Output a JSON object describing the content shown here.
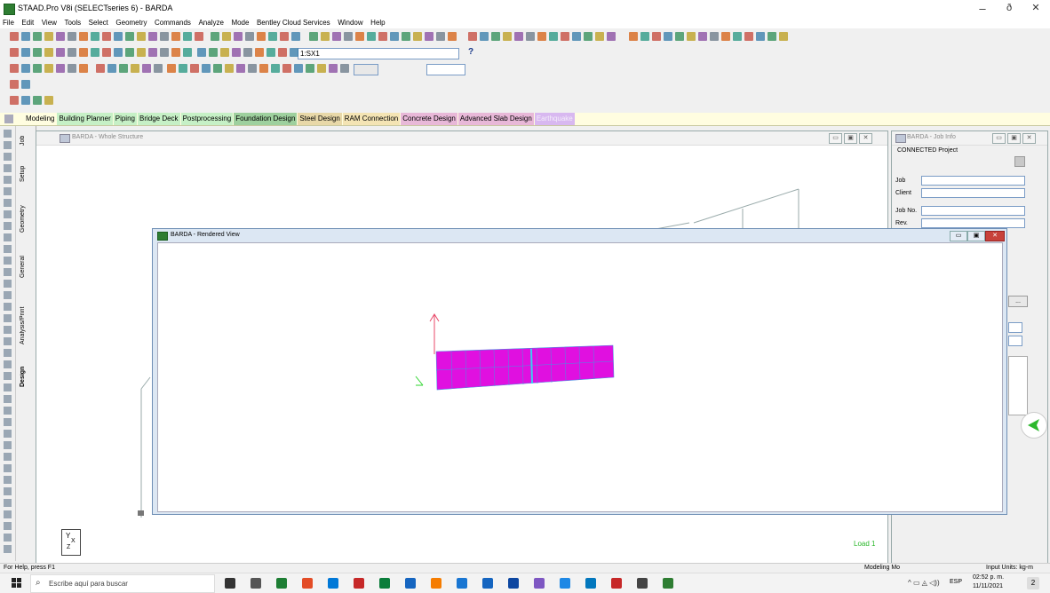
{
  "window": {
    "title": "STAAD.Pro V8i (SELECTseries 6) - BARDA",
    "controls": {
      "minimize": "–",
      "restore": "ð",
      "close": "✕"
    }
  },
  "menu": [
    "File",
    "Edit",
    "View",
    "Tools",
    "Select",
    "Geometry",
    "Commands",
    "Analyze",
    "Mode",
    "Bentley Cloud Services",
    "Window",
    "Help"
  ],
  "toolbar": {
    "load_combo": "1:SX1",
    "help_icon": "?"
  },
  "tabs": [
    {
      "label": "Modeling",
      "bg": "#fffde0"
    },
    {
      "label": "Building Planner",
      "bg": "#c6f0c6"
    },
    {
      "label": "Piping",
      "bg": "#c6f0c6"
    },
    {
      "label": "Bridge Deck",
      "bg": "#c6f0c6"
    },
    {
      "label": "Postprocessing",
      "bg": "#c6f0c6"
    },
    {
      "label": "Foundation Design",
      "bg": "#9ed09e"
    },
    {
      "label": "Steel Design",
      "bg": "#e8d8a8"
    },
    {
      "label": "RAM Connection",
      "bg": "#f4e4b4"
    },
    {
      "label": "Concrete Design",
      "bg": "#e8b8d8"
    },
    {
      "label": "Advanced Slab Design",
      "bg": "#e8b8d8"
    },
    {
      "label": "Earthquake",
      "bg": "#d8b8f0"
    }
  ],
  "page_control": [
    "Job",
    "Setup",
    "Geometry",
    "General",
    "Analysis/Print",
    "Design"
  ],
  "whole_structure": {
    "title": "BARDA - Whole Structure",
    "axis_y": "Y",
    "axis_x": "X",
    "axis_z": "Z",
    "load_label": "Load 1"
  },
  "rendered_view": {
    "title": "BARDA - Rendered View",
    "axis_y": "Y"
  },
  "job_info": {
    "title": "BARDA - Job Info",
    "group": "CONNECTED Project",
    "fields": [
      "Job",
      "Client",
      "Job No.",
      "Rev."
    ]
  },
  "status": {
    "left": "For Help, press F1",
    "mode": "Modeling Mo",
    "units": "Input Units:  kg-m"
  },
  "taskbar": {
    "search_placeholder": "Escribe aquí para buscar",
    "lang": "ESP",
    "time": "02:52 p. m.",
    "date": "11/11/2021",
    "notif": "2"
  }
}
